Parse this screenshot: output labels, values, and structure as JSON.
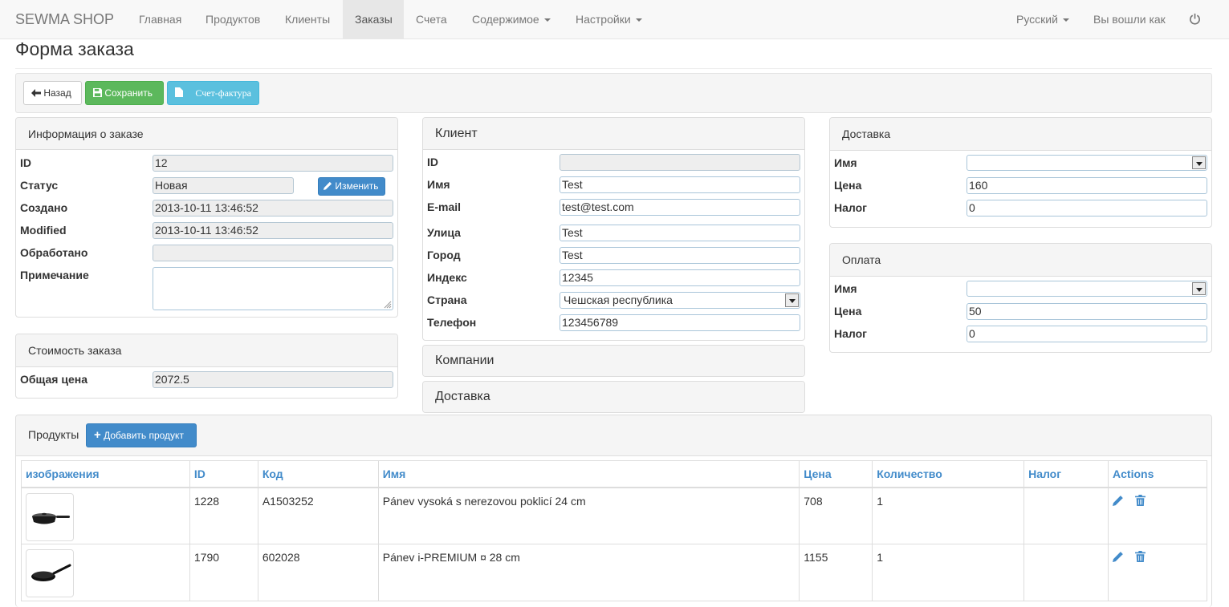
{
  "navbar": {
    "brand": "SEWMA SHOP",
    "items": [
      "Главная",
      "Продуктов",
      "Клиенты",
      "Заказы",
      "Счета",
      "Содержимое",
      "Настройки"
    ],
    "language": "Русский",
    "logged_in": "Вы вошли как",
    "power_icon": "power-icon"
  },
  "page": {
    "title": "Форма заказа"
  },
  "toolbar": {
    "back": "Назад",
    "save": "Сохранить",
    "invoice": "Счет-фактура"
  },
  "order_info": {
    "title": "Информация о заказе",
    "id_label": "ID",
    "id": "12",
    "status_label": "Статус",
    "status": "Новая",
    "change_button": "Изменить",
    "created_label": "Создано",
    "created": "2013-10-11 13:46:52",
    "modified_label": "Modified",
    "modified": "2013-10-11 13:46:52",
    "processed_label": "Обработано",
    "processed": "",
    "note_label": "Примечание",
    "note": ""
  },
  "order_cost": {
    "title": "Стоимость заказа",
    "total_label": "Общая цена",
    "total": "2072.5"
  },
  "client": {
    "title": "Клиент",
    "id_label": "ID",
    "id": "",
    "name_label": "Имя",
    "name": "Test",
    "email_label": "E-mail",
    "email": "test@test.com",
    "street_label": "Улица",
    "street": "Test",
    "city_label": "Город",
    "city": "Test",
    "zip_label": "Индекс",
    "zip": "12345",
    "country_label": "Страна",
    "country": "Чешская республика",
    "phone_label": "Телефон",
    "phone": "123456789"
  },
  "companies": {
    "title": "Компании"
  },
  "client_delivery": {
    "title": "Доставка"
  },
  "delivery": {
    "title": "Доставка",
    "name_label": "Имя",
    "name": "",
    "price_label": "Цена",
    "price": "160",
    "tax_label": "Налог",
    "tax": "0"
  },
  "payment": {
    "title": "Оплата",
    "name_label": "Имя",
    "name": "",
    "price_label": "Цена",
    "price": "50",
    "tax_label": "Налог",
    "tax": "0"
  },
  "products": {
    "title": "Продукты",
    "add_button": "Добавить продукт",
    "columns": [
      "изображения",
      "ID",
      "Код",
      "Имя",
      "Цена",
      "Количество",
      "Налог",
      "Actions"
    ],
    "rows": [
      {
        "id": "1228",
        "code": "A1503252",
        "name": "Pánev vysoká s nerezovou poklicí 24 cm",
        "price": "708",
        "qty": "1",
        "tax": ""
      },
      {
        "id": "1790",
        "code": "602028",
        "name": "Pánev i-PREMIUM ¤ 28 cm",
        "price": "1155",
        "qty": "1",
        "tax": ""
      }
    ]
  }
}
